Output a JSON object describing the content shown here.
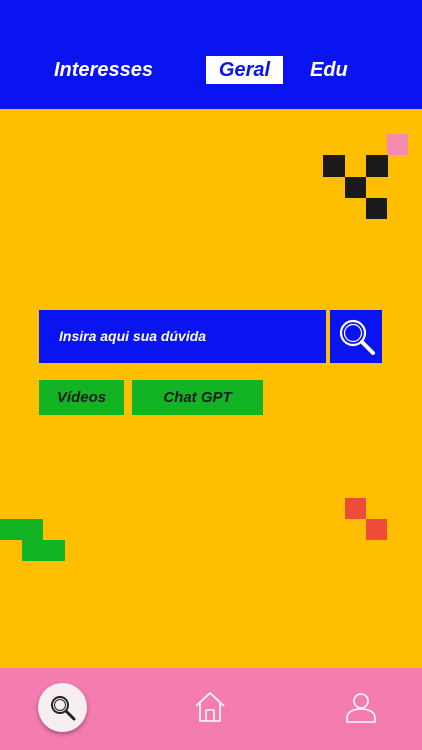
{
  "colors": {
    "background": "#FFBE00",
    "header": "#0A14F0",
    "accent_green": "#12B424",
    "bottom_nav": "#F47CAF",
    "pixel_black": "#1A1A1A",
    "pixel_pink": "#F48AB0",
    "pixel_red": "#EE4B3A"
  },
  "header": {
    "tabs": [
      {
        "label": "Interesses",
        "active": false
      },
      {
        "label": "Geral",
        "active": true
      },
      {
        "label": "Edu",
        "active": false
      }
    ]
  },
  "search": {
    "placeholder": "Insira aqui sua dúvida",
    "button_icon": "search-icon"
  },
  "filters": [
    {
      "label": "Vídeos"
    },
    {
      "label": "Chat GPT"
    }
  ],
  "bottom_nav": {
    "items": [
      {
        "icon": "search-icon",
        "active": true
      },
      {
        "icon": "home-icon",
        "active": false
      },
      {
        "icon": "user-icon",
        "active": false
      }
    ]
  }
}
